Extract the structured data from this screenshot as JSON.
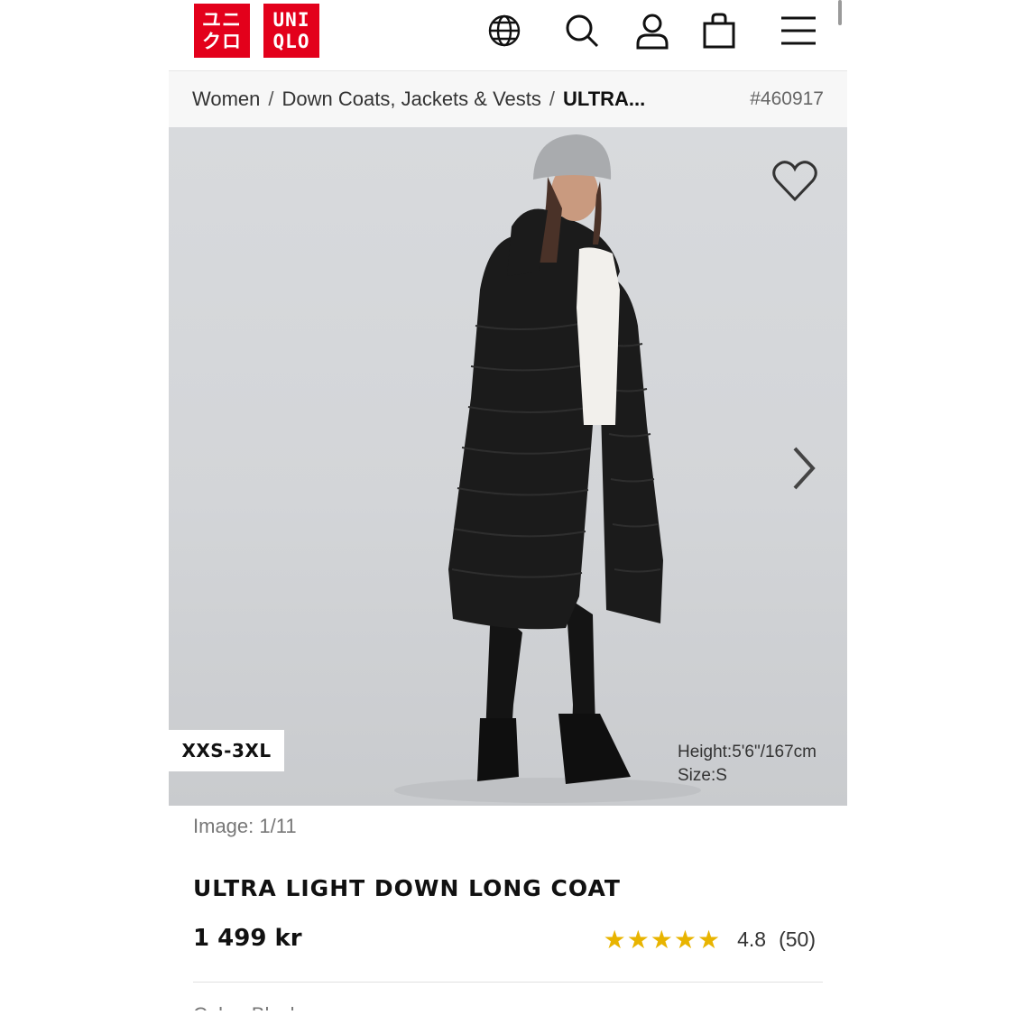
{
  "header": {
    "logo_top": [
      "ユニ",
      "クロ"
    ],
    "logo_bottom": [
      "UNI",
      "QLO"
    ],
    "icons": [
      "globe-icon",
      "search-icon",
      "account-icon",
      "cart-icon",
      "menu-icon"
    ]
  },
  "breadcrumb": {
    "items": [
      "Women",
      "Down Coats, Jackets & Vests",
      "ULTRA..."
    ],
    "separator": "/",
    "product_code": "#460917"
  },
  "hero": {
    "size_range": "XXS-3XL",
    "model_height": "Height:5'6\"/167cm",
    "model_size": "Size:S",
    "image_alt": "Model wearing black ultra light down long coat with grey beanie"
  },
  "details": {
    "image_counter": "Image: 1/11",
    "product_name": "ULTRA LIGHT DOWN LONG COAT",
    "price": "1 499 kr",
    "stars": "★★★★★",
    "rating": "4.8",
    "review_count": "(50)",
    "next_section_partial": "Color: Black"
  },
  "colors": {
    "brand_red": "#e3001b",
    "star_gold": "#e8b400"
  }
}
